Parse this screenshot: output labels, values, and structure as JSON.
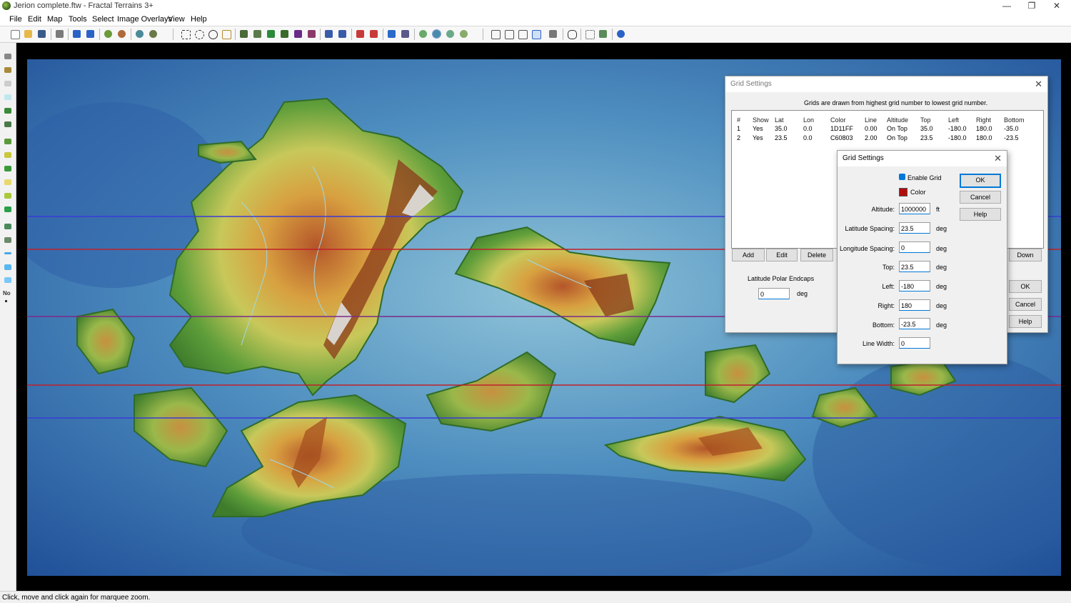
{
  "window": {
    "title": "Jerion complete.ftw - Fractal Terrains 3+",
    "min": "—",
    "restore": "❐",
    "close": "✕"
  },
  "menu": [
    "File",
    "Edit",
    "Map",
    "Tools",
    "Select",
    "Image Overlays",
    "View",
    "Help"
  ],
  "status": "Click, move and click again for marquee zoom.",
  "leftbar": {
    "no_label": "No"
  },
  "colors": {
    "map_blue_line": "#3b3bd6",
    "map_red_line": "#c0202a",
    "accent": "#0078d7",
    "grid_color_swatch": "#b10d0d"
  },
  "dlg_outer": {
    "title": "Grid Settings",
    "close": "✕",
    "note": "Grids are drawn from highest grid number to lowest grid number.",
    "columns": [
      "#",
      "Show",
      "Lat",
      "Lon",
      "Color",
      "Line",
      "Altitude",
      "Top",
      "Left",
      "Right",
      "Bottom"
    ],
    "rows": [
      [
        "1",
        "Yes",
        "35.0",
        "0.0",
        "1D11FF",
        "0.00",
        "On Top",
        "35.0",
        "-180.0",
        "180.0",
        "-35.0"
      ],
      [
        "2",
        "Yes",
        "23.5",
        "0.0",
        "C60803",
        "2.00",
        "On Top",
        "23.5",
        "-180.0",
        "180.0",
        "-23.5"
      ]
    ],
    "buttons": {
      "add": "Add",
      "edit": "Edit",
      "delete": "Delete",
      "down": "Down",
      "ok": "OK",
      "cancel": "Cancel",
      "help": "Help"
    },
    "polar_label": "Latitude Polar Endcaps",
    "polar_value": "0",
    "polar_unit": "deg"
  },
  "dlg_inner": {
    "title": "Grid Settings",
    "close": "✕",
    "enable_grid": "Enable Grid",
    "color": "Color",
    "fields": {
      "altitude": {
        "label": "Altitude:",
        "value": "1000000",
        "unit": "ft"
      },
      "lat_spacing": {
        "label": "Latitude Spacing:",
        "value": "23.5",
        "unit": "deg"
      },
      "lon_spacing": {
        "label": "Longitude Spacing:",
        "value": "0",
        "unit": "deg"
      },
      "top": {
        "label": "Top:",
        "value": "23.5",
        "unit": "deg"
      },
      "left": {
        "label": "Left:",
        "value": "-180",
        "unit": "deg"
      },
      "right": {
        "label": "Right:",
        "value": "180",
        "unit": "deg"
      },
      "bottom": {
        "label": "Bottom:",
        "value": "-23.5",
        "unit": "deg"
      },
      "line_width": {
        "label": "Line Width:",
        "value": "0",
        "unit": ""
      }
    },
    "buttons": {
      "ok": "OK",
      "cancel": "Cancel",
      "help": "Help"
    }
  }
}
